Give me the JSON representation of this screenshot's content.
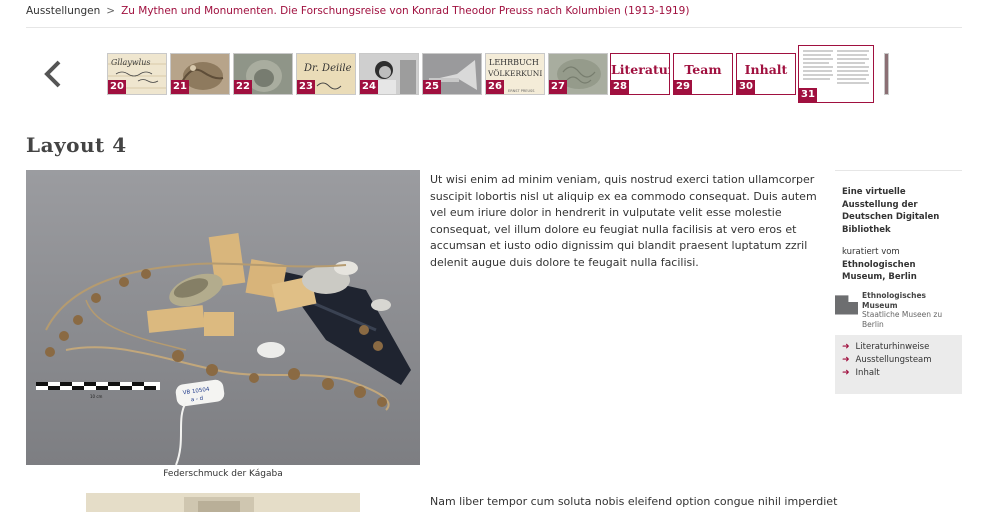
{
  "breadcrumb": {
    "home": "Ausstellungen",
    "separator": ">",
    "current": "Zu Mythen und Monumenten. Die Forschungsreise von Konrad Theodor Preuss nach Kolumbien (1913-1919)"
  },
  "thumbnails": [
    {
      "number": "20",
      "kind": "image"
    },
    {
      "number": "21",
      "kind": "image"
    },
    {
      "number": "22",
      "kind": "image"
    },
    {
      "number": "23",
      "kind": "image"
    },
    {
      "number": "24",
      "kind": "image"
    },
    {
      "number": "25",
      "kind": "image"
    },
    {
      "number": "26",
      "kind": "image"
    },
    {
      "number": "27",
      "kind": "image"
    },
    {
      "number": "28",
      "kind": "text",
      "label": "Literatur"
    },
    {
      "number": "29",
      "kind": "text",
      "label": "Team"
    },
    {
      "number": "30",
      "kind": "text",
      "label": "Inhalt"
    },
    {
      "number": "31",
      "kind": "image",
      "active": true
    }
  ],
  "thumb_text": {
    "t20": "Gllaywlus",
    "t23": "Dr. Deiile",
    "t26_line1": "LEHRBUCH",
    "t26_line2": "VÖLKERKUNI",
    "t26_line3": "ERNST PREUSS"
  },
  "page_title": "Layout 4",
  "main_image": {
    "caption": "Federschmuck der Kágaba",
    "tag_line1": "VB 10504",
    "tag_line2": "a - d",
    "scale_label": "10 cm"
  },
  "body": {
    "paragraph1": "Ut wisi enim ad minim veniam, quis nostrud exerci tation ullamcorper suscipit lobortis nisl ut aliquip ex ea commodo consequat. Duis autem vel eum iriure dolor in hendrerit in vulputate velit esse molestie consequat, vel illum dolore eu feugiat nulla facilisis at vero eros et accumsan et iusto odio dignissim qui blandit praesent luptatum zzril delenit augue duis dolore te feugait nulla facilisi.",
    "paragraph2": "Nam liber tempor cum soluta nobis eleifend option congue nihil imperdiet"
  },
  "sidebar": {
    "intro_bold": "Eine virtuelle Ausstellung der Deutschen Digitalen Bibliothek",
    "curated_by": "kuratiert vom",
    "curator_bold": "Ethnologischen Museum, Berlin",
    "logo_line1": "Ethnologisches Museum",
    "logo_line2": "Staatliche Museen zu Berlin",
    "links": [
      "Literaturhinweise",
      "Ausstellungsteam",
      "Inhalt"
    ]
  },
  "colors": {
    "accent": "#a0103f",
    "sidebar_box": "#ebebeb"
  }
}
